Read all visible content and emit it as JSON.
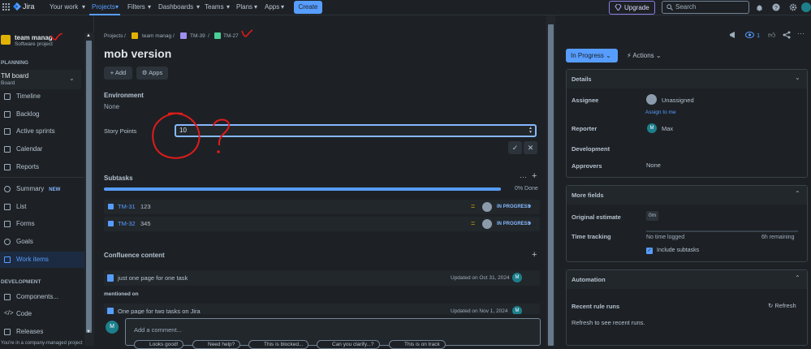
{
  "topnav": {
    "logo": "Jira",
    "items": [
      "Your work",
      "Projects",
      "Filters",
      "Dashboards",
      "Teams",
      "Plans",
      "Apps"
    ],
    "create_label": "Create",
    "upgrade_label": "Upgrade",
    "search_placeholder": "Search"
  },
  "sidebar": {
    "project_name": "team manag",
    "project_type": "Software project",
    "planning_header": "PLANNING",
    "board_name": "TM board",
    "board_sub": "Board",
    "planning_items": [
      "Timeline",
      "Backlog",
      "Active sprints",
      "Calendar",
      "Reports"
    ],
    "general_items": [
      "Summary",
      "List",
      "Forms",
      "Goals",
      "Work items"
    ],
    "new_badge": "NEW",
    "development_header": "DEVELOPMENT",
    "development_items": [
      "Components...",
      "Code",
      "Releases"
    ],
    "footer_text": "You're in a company-managed project"
  },
  "breadcrumb": [
    "Projects",
    "team manag",
    "TM-39",
    "TM-27"
  ],
  "issue": {
    "title": "mob version",
    "add_label": "Add",
    "apps_label": "Apps",
    "environment_label": "Environment",
    "environment_value": "None",
    "story_points_label": "Story Points",
    "story_points_value": "10"
  },
  "subtasks": {
    "header": "Subtasks",
    "progress_text": "0% Done",
    "progress_fraction": 0,
    "items": [
      {
        "key": "TM-31",
        "summary": "123",
        "status": "IN PROGRESS"
      },
      {
        "key": "TM-32",
        "summary": "345",
        "status": "IN PROGRESS"
      }
    ]
  },
  "confluence": {
    "header": "Confluence content",
    "pages": [
      {
        "title": "just one page for one task",
        "updated": "Updated on Oct 31, 2024"
      },
      {
        "title": "One page for two tasks on Jira",
        "updated": "Updated on Nov 1, 2024"
      }
    ],
    "mentioned_on": "mentioned on"
  },
  "comment": {
    "avatar": "M",
    "placeholder": "Add a comment...",
    "chips": [
      "Looks good!",
      "Need help?",
      "This is blocked...",
      "Can you clarify...?",
      "This is on track"
    ]
  },
  "right_panel": {
    "watch_count": "1",
    "status_label": "In Progress",
    "actions_label": "Actions",
    "details": {
      "header": "Details",
      "assignee_label": "Assignee",
      "assignee_value": "Unassigned",
      "assign_to_me": "Assign to me",
      "reporter_label": "Reporter",
      "reporter_value": "Max",
      "reporter_avatar": "M",
      "development_label": "Development",
      "approvers_label": "Approvers",
      "approvers_value": "None"
    },
    "more_fields": {
      "header": "More fields",
      "estimate_label": "Original estimate",
      "estimate_value": "0m",
      "tracking_label": "Time tracking",
      "no_time_logged": "No time logged",
      "remaining": "6h remaining",
      "include_subtasks": "Include subtasks"
    },
    "automation": {
      "header": "Automation",
      "recent_runs_label": "Recent rule runs",
      "refresh_label": "Refresh",
      "refresh_hint": "Refresh to see recent runs."
    }
  },
  "colors": {
    "accent": "#579dff",
    "background": "#1d2125",
    "annotation": "#e01b1b"
  }
}
